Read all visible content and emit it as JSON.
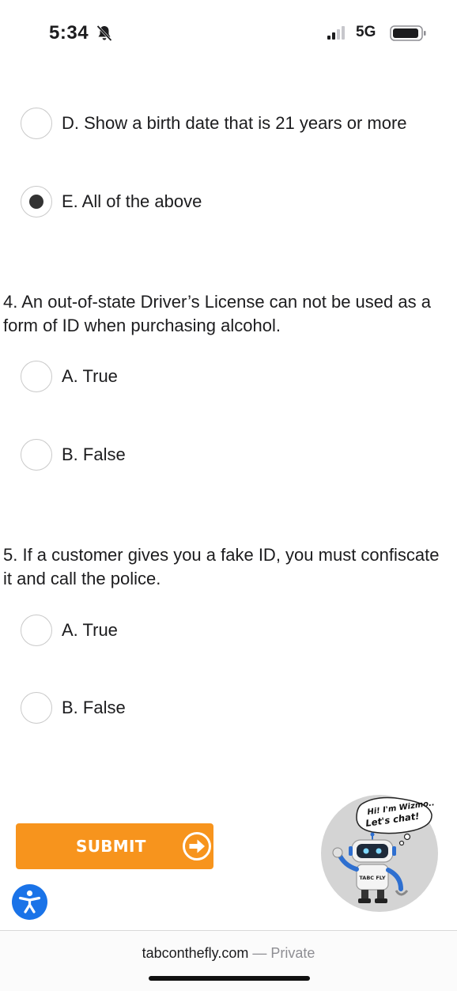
{
  "status_bar": {
    "time": "5:34",
    "network": "5G",
    "icons": [
      "bell-slash-icon",
      "cellular-signal-icon",
      "battery-icon"
    ]
  },
  "question3_options": [
    {
      "label": "D. Show a birth date that is 21 years or more",
      "selected": false
    },
    {
      "label": "E. All of the above",
      "selected": true
    }
  ],
  "questions": [
    {
      "text": "4. An out-of-state Driver’s License can not be used as a form of ID when purchasing alcohol.",
      "options": [
        {
          "label": "A. True",
          "selected": false
        },
        {
          "label": "B. False",
          "selected": false
        }
      ]
    },
    {
      "text": "5. If a customer gives you a fake ID, you must confiscate it and call the police.",
      "options": [
        {
          "label": "A. True",
          "selected": false
        },
        {
          "label": "B. False",
          "selected": false
        }
      ]
    }
  ],
  "submit": {
    "label": "SUBMIT",
    "color": "#f7941d",
    "icon": "arrow-right-icon"
  },
  "accessibility": {
    "icon": "accessibility-icon",
    "color": "#1a73e8"
  },
  "chat_widget": {
    "bubble_text_1": "Hi! I'm Wizmo..",
    "bubble_text_2": "Let's chat!",
    "badge_text": "TABC FLY"
  },
  "browser": {
    "domain": "tabconthefly.com",
    "privacy": "— Private"
  }
}
